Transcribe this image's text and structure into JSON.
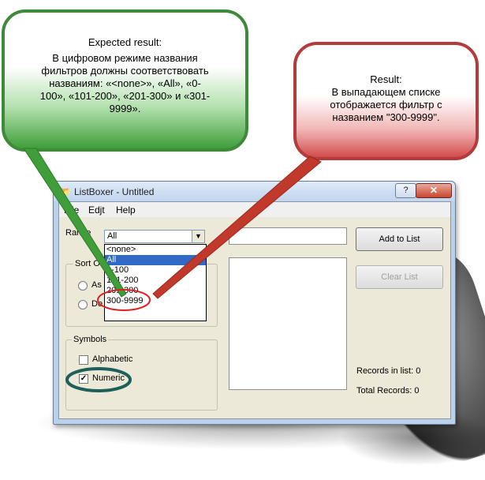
{
  "window": {
    "title": "ListBoxer - Untitled",
    "help_button": "?",
    "close_button": "✕"
  },
  "menu": [
    "File",
    "Edjt",
    "Help"
  ],
  "range": {
    "label": "Range",
    "selected": "All",
    "options": [
      "<none>",
      "All",
      "0-100",
      "101-200",
      "201-300",
      "300-9999"
    ],
    "highlighted_index": 1
  },
  "sort_order": {
    "label_partial": "Sort Ord",
    "radio1_partial": "As",
    "radio2_partial": "De"
  },
  "symbols": {
    "label": "Symbols",
    "alphabetic": {
      "label": "Alphabetic",
      "checked": false
    },
    "numeric": {
      "label": "Numeric",
      "checked": true
    }
  },
  "buttons": {
    "add_to_list": "Add to List",
    "clear_list": "Clear List"
  },
  "status": {
    "records_in_list": "Records in list: 0",
    "total_records": "Total Records: 0"
  },
  "annotations": {
    "expected_title": "Expected result:",
    "expected_lines": [
      "В цифровом режиме названия",
      "фильтров должны соответствовать",
      "названиям: «<none>», «All», «0-",
      "100», «101-200», «201-300» и «301-",
      "9999»."
    ],
    "result_title": "Result:",
    "result_lines": [
      "В выпадающем списке",
      "отображается фильтр с",
      "названием \"300-9999\"."
    ],
    "expected_color": "#3e8a3a",
    "result_color": "#c0392b",
    "numeric_highlight_color": "#1f5f5a"
  }
}
